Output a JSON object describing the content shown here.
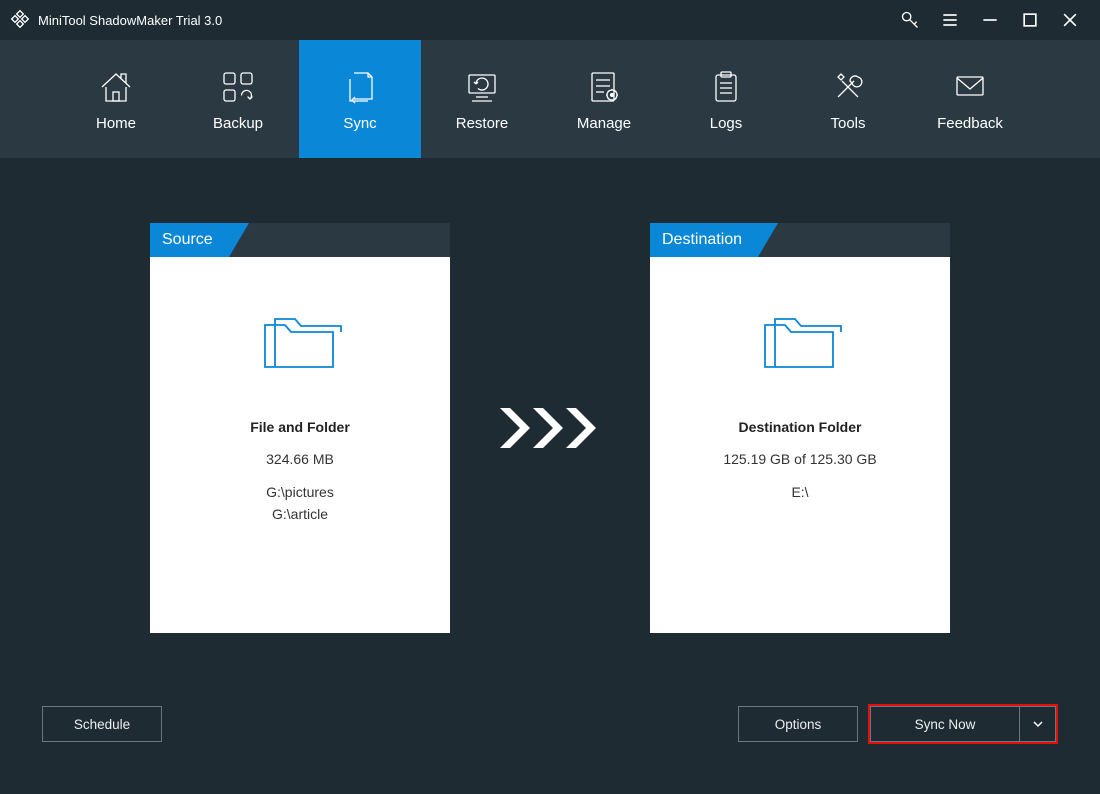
{
  "app": {
    "title": "MiniTool ShadowMaker Trial 3.0"
  },
  "nav": {
    "items": [
      {
        "label": "Home"
      },
      {
        "label": "Backup"
      },
      {
        "label": "Sync"
      },
      {
        "label": "Restore"
      },
      {
        "label": "Manage"
      },
      {
        "label": "Logs"
      },
      {
        "label": "Tools"
      },
      {
        "label": "Feedback"
      }
    ],
    "active_index": 2
  },
  "source": {
    "header": "Source",
    "title": "File and Folder",
    "size": "324.66 MB",
    "paths": [
      "G:\\pictures",
      "G:\\article"
    ]
  },
  "destination": {
    "header": "Destination",
    "title": "Destination Folder",
    "status": "125.19 GB of 125.30 GB",
    "path": "E:\\"
  },
  "buttons": {
    "schedule": "Schedule",
    "options": "Options",
    "sync_now": "Sync Now"
  }
}
